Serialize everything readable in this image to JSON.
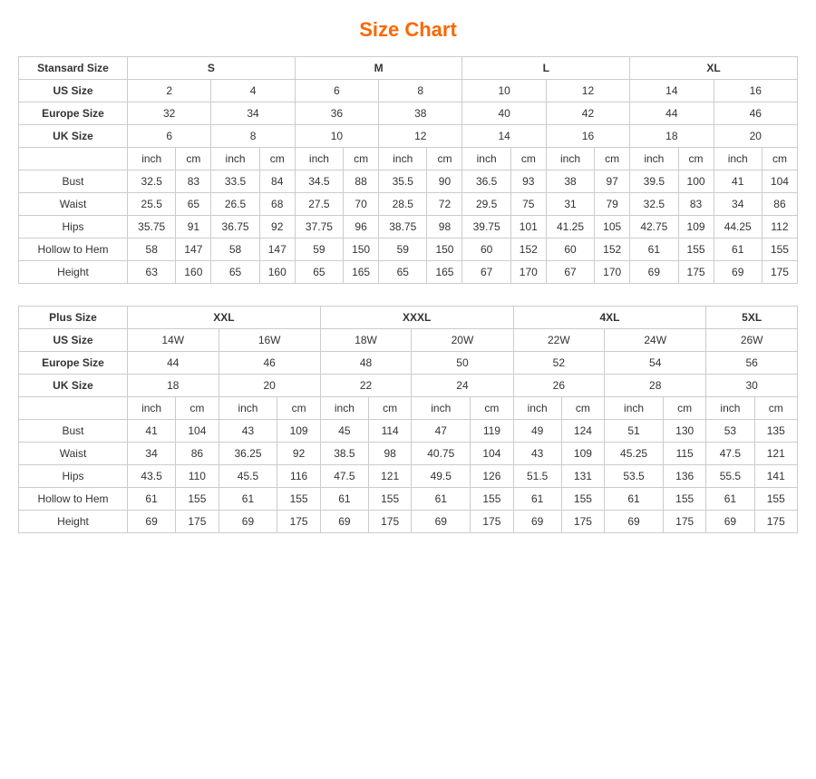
{
  "title": "Size Chart",
  "standard": {
    "header": "Stansard Size",
    "sizeGroups": [
      "S",
      "M",
      "L",
      "XL"
    ],
    "colSpans": [
      2,
      2,
      2,
      2
    ],
    "rows": {
      "usSize": {
        "label": "US Size",
        "values": [
          "2",
          "4",
          "6",
          "8",
          "10",
          "12",
          "14",
          "16"
        ]
      },
      "europeSize": {
        "label": "Europe Size",
        "values": [
          "32",
          "34",
          "36",
          "38",
          "40",
          "42",
          "44",
          "46"
        ]
      },
      "ukSize": {
        "label": "UK Size",
        "values": [
          "6",
          "8",
          "10",
          "12",
          "14",
          "16",
          "18",
          "20"
        ]
      },
      "units": [
        "inch",
        "cm",
        "inch",
        "cm",
        "inch",
        "cm",
        "inch",
        "cm",
        "inch",
        "cm",
        "inch",
        "cm",
        "inch",
        "cm",
        "inch",
        "cm"
      ],
      "bust": {
        "label": "Bust",
        "values": [
          "32.5",
          "83",
          "33.5",
          "84",
          "34.5",
          "88",
          "35.5",
          "90",
          "36.5",
          "93",
          "38",
          "97",
          "39.5",
          "100",
          "41",
          "104"
        ]
      },
      "waist": {
        "label": "Waist",
        "values": [
          "25.5",
          "65",
          "26.5",
          "68",
          "27.5",
          "70",
          "28.5",
          "72",
          "29.5",
          "75",
          "31",
          "79",
          "32.5",
          "83",
          "34",
          "86"
        ]
      },
      "hips": {
        "label": "Hips",
        "values": [
          "35.75",
          "91",
          "36.75",
          "92",
          "37.75",
          "96",
          "38.75",
          "98",
          "39.75",
          "101",
          "41.25",
          "105",
          "42.75",
          "109",
          "44.25",
          "112"
        ]
      },
      "hollowToHem": {
        "label": "Hollow to Hem",
        "values": [
          "58",
          "147",
          "58",
          "147",
          "59",
          "150",
          "59",
          "150",
          "60",
          "152",
          "60",
          "152",
          "61",
          "155",
          "61",
          "155"
        ]
      },
      "height": {
        "label": "Height",
        "values": [
          "63",
          "160",
          "65",
          "160",
          "65",
          "165",
          "65",
          "165",
          "67",
          "170",
          "67",
          "170",
          "69",
          "175",
          "69",
          "175"
        ]
      }
    }
  },
  "plus": {
    "header": "Plus Size",
    "sizeGroups": [
      "XXL",
      "XXXL",
      "4XL",
      "5XL"
    ],
    "colSpans": [
      2,
      2,
      2,
      1
    ],
    "rows": {
      "usSize": {
        "label": "US Size",
        "values": [
          "14W",
          "16W",
          "18W",
          "20W",
          "22W",
          "24W",
          "26W"
        ]
      },
      "europeSize": {
        "label": "Europe Size",
        "values": [
          "44",
          "46",
          "48",
          "50",
          "52",
          "54",
          "56"
        ]
      },
      "ukSize": {
        "label": "UK Size",
        "values": [
          "18",
          "20",
          "22",
          "24",
          "26",
          "28",
          "30"
        ]
      },
      "units": [
        "inch",
        "cm",
        "inch",
        "cm",
        "inch",
        "cm",
        "inch",
        "cm",
        "inch",
        "cm",
        "inch",
        "cm",
        "inch",
        "cm"
      ],
      "bust": {
        "label": "Bust",
        "values": [
          "41",
          "104",
          "43",
          "109",
          "45",
          "114",
          "47",
          "119",
          "49",
          "124",
          "51",
          "130",
          "53",
          "135"
        ]
      },
      "waist": {
        "label": "Waist",
        "values": [
          "34",
          "86",
          "36.25",
          "92",
          "38.5",
          "98",
          "40.75",
          "104",
          "43",
          "109",
          "45.25",
          "115",
          "47.5",
          "121"
        ]
      },
      "hips": {
        "label": "Hips",
        "values": [
          "43.5",
          "110",
          "45.5",
          "116",
          "47.5",
          "121",
          "49.5",
          "126",
          "51.5",
          "131",
          "53.5",
          "136",
          "55.5",
          "141"
        ]
      },
      "hollowToHem": {
        "label": "Hollow to Hem",
        "values": [
          "61",
          "155",
          "61",
          "155",
          "61",
          "155",
          "61",
          "155",
          "61",
          "155",
          "61",
          "155",
          "61",
          "155"
        ]
      },
      "height": {
        "label": "Height",
        "values": [
          "69",
          "175",
          "69",
          "175",
          "69",
          "175",
          "69",
          "175",
          "69",
          "175",
          "69",
          "175",
          "69",
          "175"
        ]
      }
    }
  }
}
